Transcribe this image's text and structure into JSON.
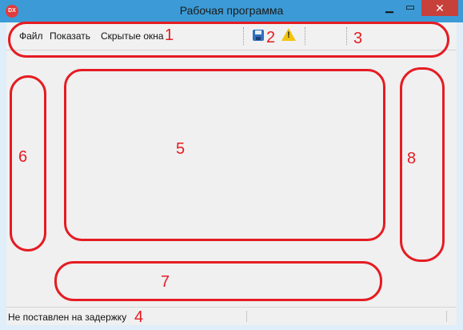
{
  "window": {
    "title": "Рабочая программа",
    "app_icon_text": "DX",
    "minimize_symbol": "▁",
    "maximize_symbol": "▭",
    "close_symbol": "✕"
  },
  "menu": {
    "items": [
      {
        "label": "Файл"
      },
      {
        "label": "Показать"
      },
      {
        "label": "Скрытые окна"
      }
    ]
  },
  "toolbar": {
    "icons": [
      "save-icon",
      "warning-icon"
    ],
    "warning_mark": "!"
  },
  "status": {
    "text": "Не поставлен на задержку"
  },
  "annotations": {
    "color": "#e51c23",
    "labels": [
      "1",
      "2",
      "3",
      "4",
      "5",
      "6",
      "7",
      "8"
    ]
  },
  "colors": {
    "titlebar": "#3c9bd6",
    "close_button": "#c7403a",
    "window_frame": "#dfeef8"
  }
}
